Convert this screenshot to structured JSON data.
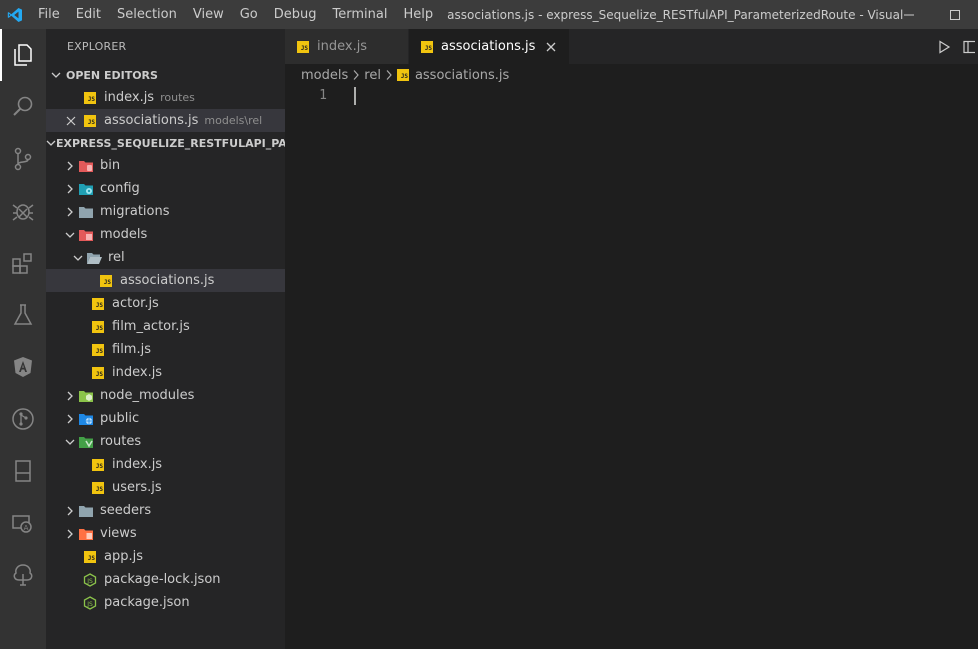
{
  "titlebar": {
    "menu": [
      "File",
      "Edit",
      "Selection",
      "View",
      "Go",
      "Debug",
      "Terminal",
      "Help"
    ],
    "window_title": "associations.js - express_Sequelize_RESTfulAPI_ParameterizedRoute - Visual Stud..."
  },
  "activitybar": {
    "items": [
      "explorer-icon",
      "search-icon",
      "source-control-icon",
      "debug-icon",
      "extensions-icon",
      "test-icon",
      "angular-icon",
      "git-history-icon",
      "remote-icon",
      "live-share-icon",
      "tree-icon"
    ]
  },
  "sidebar": {
    "title": "EXPLORER",
    "open_editors": {
      "header": "OPEN EDITORS",
      "items": [
        {
          "name": "index.js",
          "desc": "routes"
        },
        {
          "name": "associations.js",
          "desc": "models\\rel"
        }
      ]
    },
    "project": {
      "header": "EXPRESS_SEQUELIZE_RESTFULAPI_PAR...",
      "rows": [
        {
          "name": "bin"
        },
        {
          "name": "config"
        },
        {
          "name": "migrations"
        },
        {
          "name": "models"
        },
        {
          "name": "rel"
        },
        {
          "name": "associations.js"
        },
        {
          "name": "actor.js"
        },
        {
          "name": "film_actor.js"
        },
        {
          "name": "film.js"
        },
        {
          "name": "index.js"
        },
        {
          "name": "node_modules"
        },
        {
          "name": "public"
        },
        {
          "name": "routes"
        },
        {
          "name": "index.js"
        },
        {
          "name": "users.js"
        },
        {
          "name": "seeders"
        },
        {
          "name": "views"
        },
        {
          "name": "app.js"
        },
        {
          "name": "package-lock.json"
        },
        {
          "name": "package.json"
        }
      ]
    }
  },
  "tabs": [
    {
      "label": "index.js",
      "active": false
    },
    {
      "label": "associations.js",
      "active": true
    }
  ],
  "breadcrumb": [
    "models",
    "rel",
    "associations.js"
  ],
  "editor": {
    "lines": [
      "1"
    ]
  },
  "colors": {
    "accent": "#007acc",
    "js_badge": "#f1c40f"
  }
}
